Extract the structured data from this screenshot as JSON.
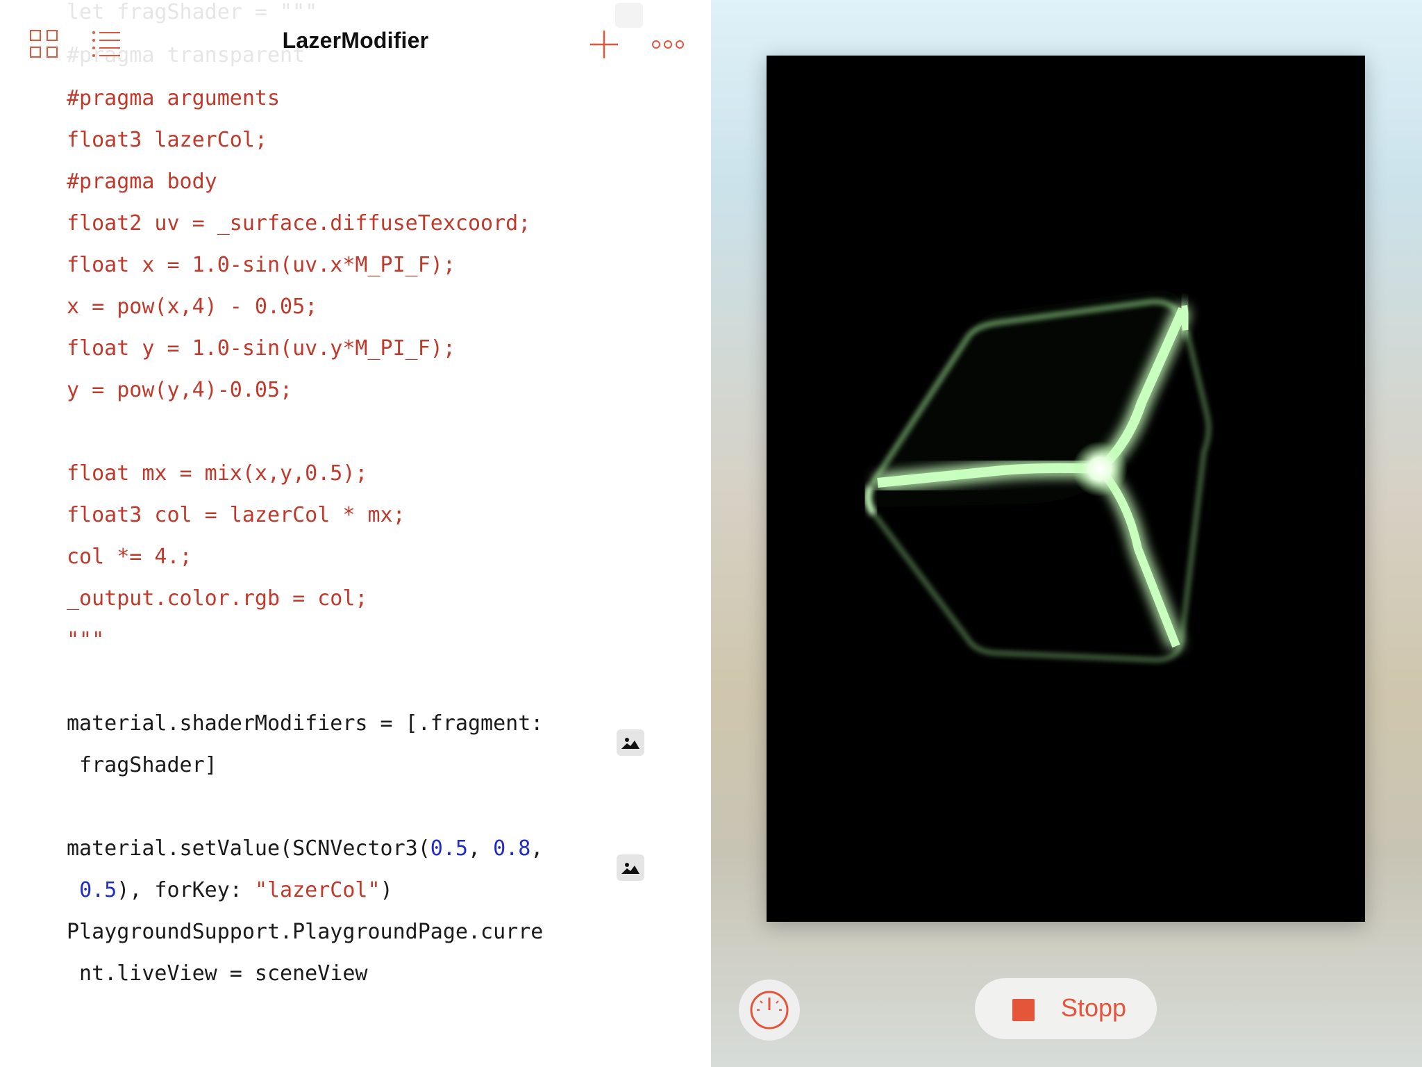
{
  "navbar": {
    "title": "LazerModifier",
    "grid_icon": "grid-icon",
    "list_icon": "list-icon",
    "plus_icon": "plus-icon",
    "more_icon": "more-icon"
  },
  "ghost_lines": [
    "let fragShader = \"\"\"",
    "#pragma transparent"
  ],
  "code": {
    "l1": "#pragma arguments",
    "l2": "float3 lazerCol;",
    "l3": "#pragma body",
    "l4": "float2 uv = _surface.diffuseTexcoord;",
    "l5": "float x = 1.0-sin(uv.x*M_PI_F);",
    "l6": "x = pow(x,4) - 0.05;",
    "l7": "float y = 1.0-sin(uv.y*M_PI_F);",
    "l8": "y = pow(y,4)-0.05;",
    "l9": "float mx = mix(x,y,0.5);",
    "l10": "float3 col = lazerCol * mx;",
    "l11": "col *= 4.;",
    "l12": "_output.color.rgb = col;",
    "l13": "\"\"\"",
    "l14": "material.shaderModifiers = [.fragment:",
    "l15": " fragShader]",
    "l16_a": "material.setValue(SCNVector3(",
    "l16_n1": "0.5",
    "l16_b": ", ",
    "l16_n2": "0.8",
    "l16_c": ",",
    "l17_a": " ",
    "l17_n3": "0.5",
    "l17_b": "), forKey: ",
    "l17_str": "\"lazerCol\"",
    "l17_c": ")",
    "l18": "PlaygroundSupport.PlaygroundPage.curre",
    "l19": " nt.liveView = sceneView"
  },
  "result_badges": [
    "image-result-icon",
    "image-result-icon"
  ],
  "live_view": {
    "speed_icon": "speedometer-icon",
    "stop_label": "Stopp",
    "stop_icon": "stop-icon"
  },
  "colors": {
    "accent": "#e4553a",
    "code_keyword": "#c0392b",
    "code_number": "#1f2cc9",
    "code_text": "#1a1a1a",
    "cube_glow": "#a6f59a",
    "scene_bg": "#000000"
  }
}
